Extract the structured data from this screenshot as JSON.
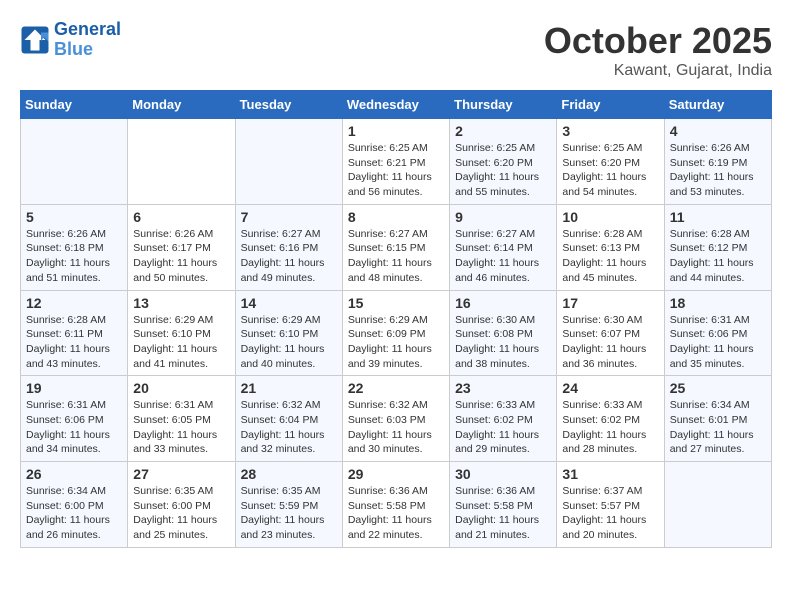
{
  "header": {
    "logo_line1": "General",
    "logo_line2": "Blue",
    "month_title": "October 2025",
    "location": "Kawant, Gujarat, India"
  },
  "weekdays": [
    "Sunday",
    "Monday",
    "Tuesday",
    "Wednesday",
    "Thursday",
    "Friday",
    "Saturday"
  ],
  "weeks": [
    [
      {
        "day": "",
        "info": ""
      },
      {
        "day": "",
        "info": ""
      },
      {
        "day": "",
        "info": ""
      },
      {
        "day": "1",
        "info": "Sunrise: 6:25 AM\nSunset: 6:21 PM\nDaylight: 11 hours\nand 56 minutes."
      },
      {
        "day": "2",
        "info": "Sunrise: 6:25 AM\nSunset: 6:20 PM\nDaylight: 11 hours\nand 55 minutes."
      },
      {
        "day": "3",
        "info": "Sunrise: 6:25 AM\nSunset: 6:20 PM\nDaylight: 11 hours\nand 54 minutes."
      },
      {
        "day": "4",
        "info": "Sunrise: 6:26 AM\nSunset: 6:19 PM\nDaylight: 11 hours\nand 53 minutes."
      }
    ],
    [
      {
        "day": "5",
        "info": "Sunrise: 6:26 AM\nSunset: 6:18 PM\nDaylight: 11 hours\nand 51 minutes."
      },
      {
        "day": "6",
        "info": "Sunrise: 6:26 AM\nSunset: 6:17 PM\nDaylight: 11 hours\nand 50 minutes."
      },
      {
        "day": "7",
        "info": "Sunrise: 6:27 AM\nSunset: 6:16 PM\nDaylight: 11 hours\nand 49 minutes."
      },
      {
        "day": "8",
        "info": "Sunrise: 6:27 AM\nSunset: 6:15 PM\nDaylight: 11 hours\nand 48 minutes."
      },
      {
        "day": "9",
        "info": "Sunrise: 6:27 AM\nSunset: 6:14 PM\nDaylight: 11 hours\nand 46 minutes."
      },
      {
        "day": "10",
        "info": "Sunrise: 6:28 AM\nSunset: 6:13 PM\nDaylight: 11 hours\nand 45 minutes."
      },
      {
        "day": "11",
        "info": "Sunrise: 6:28 AM\nSunset: 6:12 PM\nDaylight: 11 hours\nand 44 minutes."
      }
    ],
    [
      {
        "day": "12",
        "info": "Sunrise: 6:28 AM\nSunset: 6:11 PM\nDaylight: 11 hours\nand 43 minutes."
      },
      {
        "day": "13",
        "info": "Sunrise: 6:29 AM\nSunset: 6:10 PM\nDaylight: 11 hours\nand 41 minutes."
      },
      {
        "day": "14",
        "info": "Sunrise: 6:29 AM\nSunset: 6:10 PM\nDaylight: 11 hours\nand 40 minutes."
      },
      {
        "day": "15",
        "info": "Sunrise: 6:29 AM\nSunset: 6:09 PM\nDaylight: 11 hours\nand 39 minutes."
      },
      {
        "day": "16",
        "info": "Sunrise: 6:30 AM\nSunset: 6:08 PM\nDaylight: 11 hours\nand 38 minutes."
      },
      {
        "day": "17",
        "info": "Sunrise: 6:30 AM\nSunset: 6:07 PM\nDaylight: 11 hours\nand 36 minutes."
      },
      {
        "day": "18",
        "info": "Sunrise: 6:31 AM\nSunset: 6:06 PM\nDaylight: 11 hours\nand 35 minutes."
      }
    ],
    [
      {
        "day": "19",
        "info": "Sunrise: 6:31 AM\nSunset: 6:06 PM\nDaylight: 11 hours\nand 34 minutes."
      },
      {
        "day": "20",
        "info": "Sunrise: 6:31 AM\nSunset: 6:05 PM\nDaylight: 11 hours\nand 33 minutes."
      },
      {
        "day": "21",
        "info": "Sunrise: 6:32 AM\nSunset: 6:04 PM\nDaylight: 11 hours\nand 32 minutes."
      },
      {
        "day": "22",
        "info": "Sunrise: 6:32 AM\nSunset: 6:03 PM\nDaylight: 11 hours\nand 30 minutes."
      },
      {
        "day": "23",
        "info": "Sunrise: 6:33 AM\nSunset: 6:02 PM\nDaylight: 11 hours\nand 29 minutes."
      },
      {
        "day": "24",
        "info": "Sunrise: 6:33 AM\nSunset: 6:02 PM\nDaylight: 11 hours\nand 28 minutes."
      },
      {
        "day": "25",
        "info": "Sunrise: 6:34 AM\nSunset: 6:01 PM\nDaylight: 11 hours\nand 27 minutes."
      }
    ],
    [
      {
        "day": "26",
        "info": "Sunrise: 6:34 AM\nSunset: 6:00 PM\nDaylight: 11 hours\nand 26 minutes."
      },
      {
        "day": "27",
        "info": "Sunrise: 6:35 AM\nSunset: 6:00 PM\nDaylight: 11 hours\nand 25 minutes."
      },
      {
        "day": "28",
        "info": "Sunrise: 6:35 AM\nSunset: 5:59 PM\nDaylight: 11 hours\nand 23 minutes."
      },
      {
        "day": "29",
        "info": "Sunrise: 6:36 AM\nSunset: 5:58 PM\nDaylight: 11 hours\nand 22 minutes."
      },
      {
        "day": "30",
        "info": "Sunrise: 6:36 AM\nSunset: 5:58 PM\nDaylight: 11 hours\nand 21 minutes."
      },
      {
        "day": "31",
        "info": "Sunrise: 6:37 AM\nSunset: 5:57 PM\nDaylight: 11 hours\nand 20 minutes."
      },
      {
        "day": "",
        "info": ""
      }
    ]
  ]
}
